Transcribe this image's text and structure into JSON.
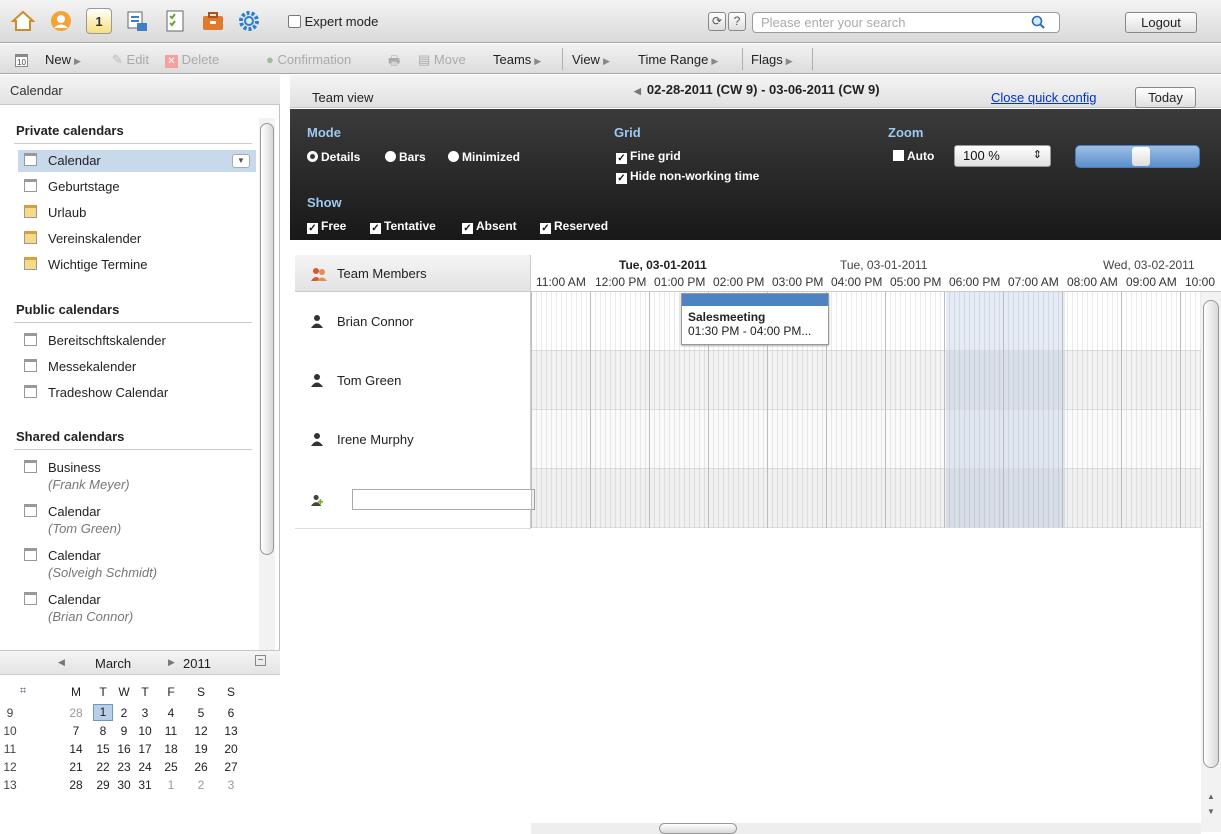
{
  "topbar": {
    "apps": [
      {
        "icon": "home-icon",
        "color": "#e8a23c"
      },
      {
        "icon": "contacts-icon",
        "color": "#f0a030"
      },
      {
        "icon": "calendar-app-icon",
        "color": "#f3c442"
      },
      {
        "icon": "messaging-icon",
        "color": "#3f7fc8"
      },
      {
        "icon": "tasks-icon",
        "color": "#8bbf3f"
      },
      {
        "icon": "infostore-icon",
        "color": "#e27a2d"
      },
      {
        "icon": "gear-icon",
        "color": "#2a7fd0"
      }
    ],
    "expert_mode": "Expert mode",
    "refresh": "⟳",
    "help": "?",
    "search_placeholder": "Please enter your search",
    "logout": "Logout"
  },
  "toolbar": {
    "cal_icon_num": "10",
    "new": "New",
    "edit": "Edit",
    "delete": "Delete",
    "confirmation": "Confirmation",
    "move": "Move",
    "teams": "Teams",
    "view": "View",
    "time_range": "Time Range",
    "flags": "Flags"
  },
  "left": {
    "header": "Calendar",
    "private_title": "Private calendars",
    "private": [
      "Calendar",
      "Geburtstage",
      "Urlaub",
      "Vereinskalender",
      "Wichtige Termine"
    ],
    "public_title": "Public calendars",
    "public": [
      "Bereitschftskalender",
      "Messekalender",
      "Tradeshow Calendar"
    ],
    "shared_title": "Shared calendars",
    "shared": [
      {
        "name": "Business",
        "owner": "(Frank Meyer)"
      },
      {
        "name": "Calendar",
        "owner": "(Tom Green)"
      },
      {
        "name": "Calendar",
        "owner": "(Solveigh Schmidt)"
      },
      {
        "name": "Calendar",
        "owner": "(Brian Connor)"
      }
    ]
  },
  "minical": {
    "month": "March",
    "year": "2011",
    "weekdays": [
      "M",
      "T",
      "W",
      "T",
      "F",
      "S",
      "S"
    ],
    "weeks": [
      {
        "wk": "9",
        "days": [
          "28",
          "1",
          "2",
          "3",
          "4",
          "5",
          "6"
        ]
      },
      {
        "wk": "10",
        "days": [
          "7",
          "8",
          "9",
          "10",
          "11",
          "12",
          "13"
        ]
      },
      {
        "wk": "11",
        "days": [
          "14",
          "15",
          "16",
          "17",
          "18",
          "19",
          "20"
        ]
      },
      {
        "wk": "12",
        "days": [
          "21",
          "22",
          "23",
          "24",
          "25",
          "26",
          "27"
        ]
      },
      {
        "wk": "13",
        "days": [
          "28",
          "29",
          "30",
          "31",
          "1",
          "2",
          "3"
        ]
      }
    ],
    "selected_day": "1"
  },
  "main": {
    "title": "Team view",
    "date_range": "02-28-2011 (CW 9) - 03-06-2011 (CW 9)",
    "close_quick": "Close quick config",
    "today": "Today"
  },
  "config": {
    "mode_label": "Mode",
    "mode_options": [
      "Details",
      "Bars",
      "Minimized"
    ],
    "mode_selected": "Details",
    "grid_label": "Grid",
    "fine_grid": "Fine grid",
    "hide_nonworking": "Hide non-working time",
    "zoom_label": "Zoom",
    "auto": "Auto",
    "zoom_value": "100 %",
    "show_label": "Show",
    "show_options": [
      "Free",
      "Tentative",
      "Absent",
      "Reserved"
    ]
  },
  "team": {
    "header": "Team Members",
    "members": [
      "Brian Connor",
      "Tom Green",
      "Irene Murphy"
    ]
  },
  "timeline": {
    "days": [
      "Tue, 03-01-2011",
      "Tue, 03-01-2011",
      "Wed, 03-02-2011"
    ],
    "hours": [
      "11:00 AM",
      "12:00 PM",
      "01:00 PM",
      "02:00 PM",
      "03:00 PM",
      "04:00 PM",
      "05:00 PM",
      "06:00 PM",
      "07:00 AM",
      "08:00 AM",
      "09:00 AM",
      "10:00"
    ]
  },
  "event": {
    "title": "Salesmeeting",
    "time": "01:30 PM - 04:00 PM..."
  }
}
